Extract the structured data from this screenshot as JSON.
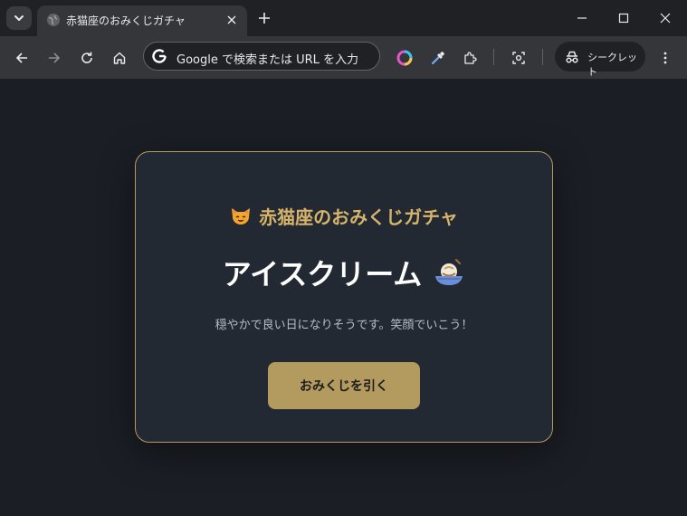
{
  "browser": {
    "tab_title": "赤猫座のおみくじガチャ",
    "omnibox_placeholder": "Google で検索または URL を入力",
    "incognito_label": "シークレット"
  },
  "page": {
    "title": "赤猫座のおみくじガチャ",
    "result": "アイスクリーム",
    "message": "穏やかで良い日になりそうです。笑顔でいこう！",
    "button_label": "おみくじを引く"
  },
  "colors": {
    "background": "#1b1e25",
    "card": "#232933",
    "accent": "#b39a5f",
    "title": "#d6b46b"
  },
  "icons": {
    "title_icon": "cat-face-icon",
    "result_icon": "ice-cream-icon"
  }
}
